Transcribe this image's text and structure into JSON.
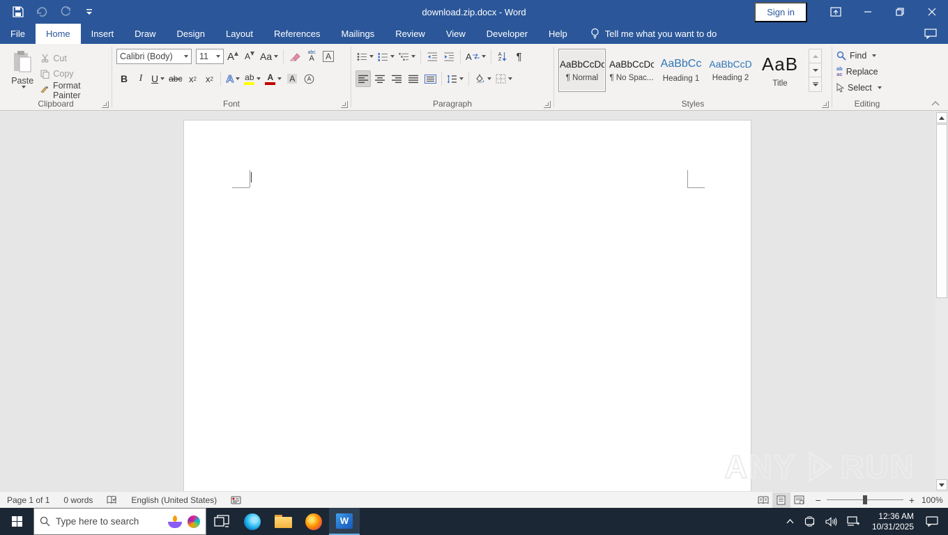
{
  "colors": {
    "titlebar_blue": "#2b579a",
    "ribbon_bg": "#f3f2f1",
    "doc_bg": "#e6e6e6",
    "taskbar_dark": "#1b2735",
    "heading_blue": "#2e74b5",
    "highlight_yellow": "#ffff00",
    "font_color_red": "#c00000"
  },
  "titlebar": {
    "title": "download.zip.docx  -  Word",
    "sign_in_label": "Sign in"
  },
  "tabs": {
    "items": [
      {
        "label": "File"
      },
      {
        "label": "Home"
      },
      {
        "label": "Insert"
      },
      {
        "label": "Draw"
      },
      {
        "label": "Design"
      },
      {
        "label": "Layout"
      },
      {
        "label": "References"
      },
      {
        "label": "Mailings"
      },
      {
        "label": "Review"
      },
      {
        "label": "View"
      },
      {
        "label": "Developer"
      },
      {
        "label": "Help"
      }
    ],
    "tell_me": "Tell me what you want to do"
  },
  "ribbon": {
    "clipboard": {
      "group_label": "Clipboard",
      "paste": "Paste",
      "cut": "Cut",
      "copy": "Copy",
      "format_painter": "Format Painter"
    },
    "font": {
      "group_label": "Font",
      "name": "Calibri (Body)",
      "size": "11",
      "glyphs": {
        "grow": "A",
        "shrink": "A",
        "change_case": "Aa",
        "bold": "B",
        "italic": "I",
        "underline": "U",
        "strike": "abc",
        "sub_base": "x",
        "sub_mark": "2",
        "sup_base": "x",
        "sup_mark": "2",
        "text_effects": "A",
        "highlight": "ab",
        "font_color": "A",
        "char_shading": "A",
        "phonetic_top": "abc",
        "phonetic_bottom": "A",
        "char_border": "A"
      }
    },
    "paragraph": {
      "group_label": "Paragraph",
      "glyphs": {
        "pilcrow": "¶",
        "sort_a": "A",
        "sort_z": "Z",
        "asian": "A"
      }
    },
    "styles": {
      "group_label": "Styles",
      "items": [
        {
          "preview": "AaBbCcDc",
          "name": "¶ Normal"
        },
        {
          "preview": "AaBbCcDc",
          "name": "¶ No Spac..."
        },
        {
          "preview": "AaBbCc",
          "name": "Heading 1"
        },
        {
          "preview": "AaBbCcD",
          "name": "Heading 2"
        },
        {
          "preview": "AaB",
          "name": "Title"
        }
      ]
    },
    "editing": {
      "group_label": "Editing",
      "find": "Find",
      "replace": "Replace",
      "select": "Select",
      "replace_icon_top": "ab",
      "replace_icon_bottom": "ac"
    }
  },
  "statusbar": {
    "page": "Page 1 of 1",
    "words": "0 words",
    "language": "English (United States)",
    "zoom_out": "−",
    "zoom_in": "+",
    "zoom_level": "100%"
  },
  "watermark": {
    "left": "ANY",
    "right": "RUN"
  },
  "taskbar": {
    "search_placeholder": "Type here to search",
    "time": "12:36 AM",
    "date": "10/31/2025"
  }
}
